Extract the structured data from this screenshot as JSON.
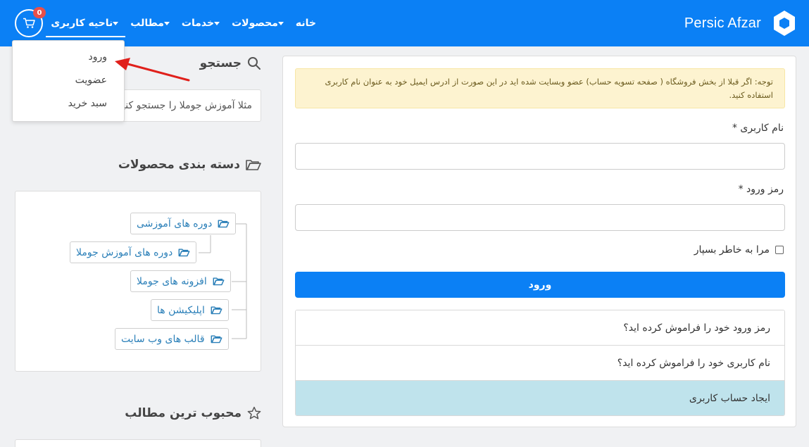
{
  "header": {
    "brand": "Persic Afzar",
    "nav": [
      "خانه",
      "محصولات",
      "خدمات",
      "مطالب",
      "ناحیه کاربری"
    ],
    "cart_count": "0"
  },
  "dropdown": {
    "items": [
      "ورود",
      "عضویت",
      "سبد خرید"
    ]
  },
  "sidebar": {
    "search_title": "جستجو",
    "search_placeholder": "مثلا آموزش جوملا را جستجو کنید",
    "categories_title": "دسته بندی محصولات",
    "categories": [
      "دوره های آموزشی",
      "دوره های آموزش جوملا",
      "افزونه های جوملا",
      "اپلیکیشن ها",
      "قالب های وب سایت"
    ],
    "popular_title": "محبوب ترین مطالب"
  },
  "login": {
    "notice": "توجه: اگر قبلا از بخش فروشگاه ( صفحه تسویه حساب) عضو وبسایت شده اید در این صورت از ادرس ایمیل خود به عنوان نام کاربری استفاده کنید.",
    "username_label": "نام کاربری *",
    "password_label": "رمز ورود *",
    "remember_label": "مرا به خاطر بسپار",
    "submit_label": "ورود",
    "links": [
      "رمز ورود خود را فراموش کرده اید؟",
      "نام کاربری خود را فراموش کرده اید؟",
      "ایجاد حساب کاربری"
    ]
  },
  "colors": {
    "primary": "#0b80f5",
    "badge": "#e8504a",
    "alert_bg": "#fdf3d0",
    "highlight": "#bfe3ec",
    "link_text": "#2a7fb8",
    "annotation_arrow": "#e0201b"
  }
}
